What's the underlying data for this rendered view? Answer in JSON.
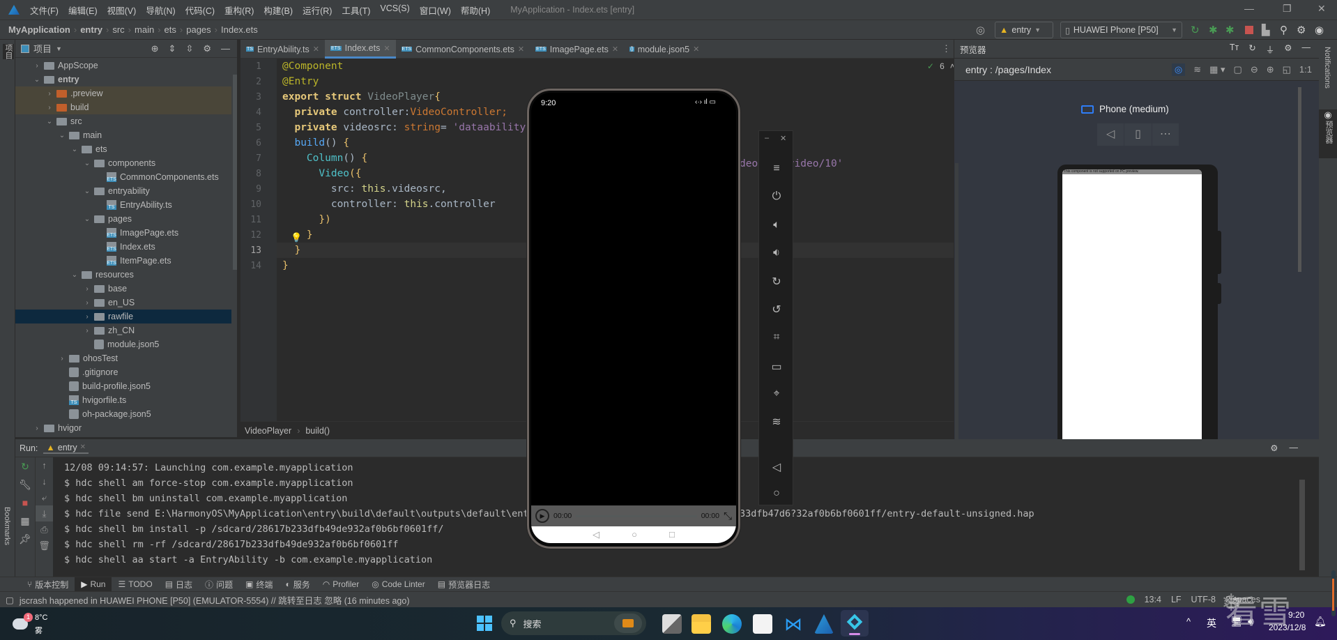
{
  "menu": {
    "items": [
      "文件(F)",
      "编辑(E)",
      "视图(V)",
      "导航(N)",
      "代码(C)",
      "重构(R)",
      "构建(B)",
      "运行(R)",
      "工具(T)",
      "VCS(S)",
      "窗口(W)",
      "帮助(H)"
    ],
    "window_title": "MyApplication - Index.ets [entry]"
  },
  "breadcrumb": [
    "MyApplication",
    "entry",
    "src",
    "main",
    "ets",
    "pages",
    "Index.ets"
  ],
  "toolbar": {
    "module_select": "entry",
    "device_select": "HUAWEI Phone [P50]",
    "accent_run": "#499c54",
    "accent_stop": "#c75450"
  },
  "left_strip": {
    "project": "项目",
    "bookmarks": "Bookmarks",
    "structure": "结构"
  },
  "project": {
    "title": "项目",
    "tree": [
      {
        "label": "AppScope",
        "level": 0,
        "type": "folder",
        "expand": "closed"
      },
      {
        "label": "entry",
        "level": 0,
        "type": "module",
        "expand": "open",
        "bold": true
      },
      {
        "label": ".preview",
        "level": 1,
        "type": "folder-excluded",
        "expand": "closed"
      },
      {
        "label": "build",
        "level": 1,
        "type": "folder-excluded",
        "expand": "closed"
      },
      {
        "label": "src",
        "level": 1,
        "type": "folder",
        "expand": "open"
      },
      {
        "label": "main",
        "level": 2,
        "type": "folder",
        "expand": "open"
      },
      {
        "label": "ets",
        "level": 3,
        "type": "folder",
        "expand": "open"
      },
      {
        "label": "components",
        "level": 4,
        "type": "folder",
        "expand": "open"
      },
      {
        "label": "CommonComponents.ets",
        "level": 5,
        "type": "ets"
      },
      {
        "label": "entryability",
        "level": 4,
        "type": "folder",
        "expand": "open"
      },
      {
        "label": "EntryAbility.ts",
        "level": 5,
        "type": "ts"
      },
      {
        "label": "pages",
        "level": 4,
        "type": "folder",
        "expand": "open"
      },
      {
        "label": "ImagePage.ets",
        "level": 5,
        "type": "ets"
      },
      {
        "label": "Index.ets",
        "level": 5,
        "type": "ets"
      },
      {
        "label": "ItemPage.ets",
        "level": 5,
        "type": "ets"
      },
      {
        "label": "resources",
        "level": 3,
        "type": "folder",
        "expand": "open"
      },
      {
        "label": "base",
        "level": 4,
        "type": "folder",
        "expand": "closed"
      },
      {
        "label": "en_US",
        "level": 4,
        "type": "folder",
        "expand": "closed"
      },
      {
        "label": "rawfile",
        "level": 4,
        "type": "folder",
        "expand": "closed",
        "selected": true
      },
      {
        "label": "zh_CN",
        "level": 4,
        "type": "folder",
        "expand": "closed"
      },
      {
        "label": "module.json5",
        "level": 4,
        "type": "json"
      },
      {
        "label": "ohosTest",
        "level": 2,
        "type": "folder",
        "expand": "closed"
      },
      {
        "label": ".gitignore",
        "level": 2,
        "type": "json"
      },
      {
        "label": "build-profile.json5",
        "level": 2,
        "type": "json"
      },
      {
        "label": "hvigorfile.ts",
        "level": 2,
        "type": "ts"
      },
      {
        "label": "oh-package.json5",
        "level": 2,
        "type": "json"
      },
      {
        "label": "hvigor",
        "level": 0,
        "type": "folder",
        "expand": "closed"
      }
    ]
  },
  "editor": {
    "tabs": [
      {
        "label": "EntryAbility.ts",
        "icon": "TS"
      },
      {
        "label": "Index.ets",
        "icon": "ETS",
        "active": true
      },
      {
        "label": "CommonComponents.ets",
        "icon": "ETS"
      },
      {
        "label": "ImagePage.ets",
        "icon": "ETS"
      },
      {
        "label": "module.json5",
        "icon": "{}"
      }
    ],
    "inspection_count": "6",
    "current_line": 13,
    "lines": [
      [
        [
          "@Component",
          "ann"
        ]
      ],
      [
        [
          "@Entry",
          "ann"
        ]
      ],
      [
        [
          "export struct ",
          "kw"
        ],
        [
          "VideoPlayer",
          "struct"
        ],
        [
          "{",
          "brace"
        ]
      ],
      [
        [
          "  private ",
          "kw"
        ],
        [
          "controller:",
          "plain"
        ],
        [
          "VideoController",
          "type"
        ],
        [
          ";",
          "type"
        ]
      ],
      [
        [
          "  private ",
          "kw"
        ],
        [
          "videosrc: ",
          "plain"
        ],
        [
          "string",
          "type"
        ],
        [
          "= ",
          "plain"
        ],
        [
          "'dataability://d",
          "str"
        ]
      ],
      [
        [
          "  build",
          "fn"
        ],
        [
          "() ",
          "plain"
        ],
        [
          "{",
          "brace"
        ]
      ],
      [
        [
          "    Column",
          "comp"
        ],
        [
          "() ",
          "plain"
        ],
        [
          "{",
          "brace"
        ]
      ],
      [
        [
          "      Video",
          "comp"
        ],
        [
          "({",
          "brace"
        ]
      ],
      [
        [
          "        src: ",
          "plain"
        ],
        [
          "this",
          "this"
        ],
        [
          ".videosrc,",
          "plain"
        ]
      ],
      [
        [
          "        controller: ",
          "plain"
        ],
        [
          "this",
          "this"
        ],
        [
          ".controller",
          "plain"
        ]
      ],
      [
        [
          "      })",
          "brace"
        ]
      ],
      [
        [
          "    }",
          "brace"
        ]
      ],
      [
        [
          "  }",
          "brace"
        ]
      ],
      [
        [
          "}",
          "brace"
        ]
      ]
    ],
    "line5_tail": "deodata/video/10'",
    "crumbs": [
      "VideoPlayer",
      "build()"
    ]
  },
  "preview": {
    "title": "预览器",
    "route": "entry : /pages/Index",
    "device_label": "Phone (medium)",
    "zoom_label": "1:1",
    "message": "This component is not supported on PC preview."
  },
  "right_strip": {
    "notifications": "Notifications",
    "previewer": "预览器"
  },
  "emulator": {
    "time": "9:20",
    "video_current": "00:00",
    "video_total": "00:00",
    "video_progress": 0
  },
  "run": {
    "label": "Run:",
    "tab": "entry",
    "lines": [
      "12/08 09:14:57: Launching com.example.myapplication",
      "$ hdc shell am force-stop com.example.myapplication",
      "$ hdc shell bm uninstall com.example.myapplication",
      "$ hdc file send E:\\HarmonyOS\\MyApplication\\entry\\build\\default\\outputs\\default\\entr",
      "$ hdc shell bm install -p /sdcard/28617b233dfb49de932af0b6bf0601ff/",
      "$ hdc shell rm -rf /sdcard/28617b233dfb49de932af0b6bf0601ff",
      "$ hdc shell aa start -a EntryAbility -b com.example.myapplication"
    ],
    "line4_tail": "33dfb47d6?32af0b6bf0601ff/entry-default-unsigned.hap"
  },
  "tool_windows": [
    "版本控制",
    "Run",
    "TODO",
    "日志",
    "问题",
    "终端",
    "服务",
    "Profiler",
    "Code Linter",
    "预览器日志"
  ],
  "status": {
    "message": "jscrash happened in HUAWEI PHONE [P50] (EMULATOR-5554) // 跳转至日志   忽略 (16 minutes ago)",
    "position": "13:4",
    "line_ending": "LF",
    "encoding": "UTF-8",
    "indent": "2 spaces"
  },
  "taskbar": {
    "weather_temp": "8°C",
    "weather_desc": "雾",
    "weather_badge": "1",
    "search": "搜索",
    "ime": "英",
    "time": "9:20",
    "date": "2023/12/8"
  },
  "watermark": "看雪"
}
